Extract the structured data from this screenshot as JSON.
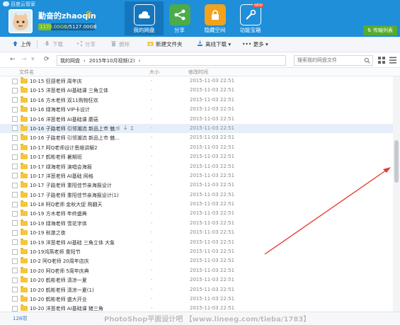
{
  "app": {
    "title": "百度云管家",
    "username": "勤奋的zhaoqin",
    "quota_used": "1170.00GB",
    "quota_sep": "/",
    "quota_total": "5127.00GB",
    "quota_fraction": 0.228,
    "transfer_label": "传输列表"
  },
  "nav": {
    "tabs": [
      {
        "label": "我的网盘",
        "icon": "cloud-icon"
      },
      {
        "label": "分享",
        "icon": "share-icon"
      },
      {
        "label": "隐藏空间",
        "icon": "lock-icon"
      },
      {
        "label": "功能宝箱",
        "icon": "toolbox-icon"
      }
    ],
    "new_tag": "NEW"
  },
  "toolbar": {
    "upload": "上传",
    "download": "下载",
    "share": "分享",
    "delete": "删除",
    "new_folder": "新建文件夹",
    "offline_download": "离线下载",
    "more": "更多"
  },
  "address": {
    "crumbs": [
      "我的网盘",
      "›",
      "2015年10月视频(2)",
      "›"
    ],
    "search_placeholder": "搜索我的网盘文件"
  },
  "columns": {
    "name": "文件名",
    "size": "大小",
    "modified": "修改时间"
  },
  "files": [
    {
      "name": "10-15 狂感老师 周年庆",
      "size": "-",
      "date": "2015-11-03 22:51"
    },
    {
      "name": "10-15 洋葱老师 AI基础课 三角立体",
      "size": "-",
      "date": "2015-11-03 22:51"
    },
    {
      "name": "10-16 方木老师 双11购物狂欢",
      "size": "-",
      "date": "2015-11-03 22:51"
    },
    {
      "name": "10-16 绿海老师 VIP卡设计",
      "size": "-",
      "date": "2015-11-03 22:51"
    },
    {
      "name": "10-16 洋葱老师 AI基础课 蘑菇",
      "size": "-",
      "date": "2015-11-03 22:51"
    },
    {
      "name": "10-16 子路老师 引领潮流 新品上市 魅...",
      "size": "-",
      "date": "2015-11-03 22:51",
      "selected": true
    },
    {
      "name": "10-16 子路老师 引领潮流 新品上市 魅...",
      "size": "-",
      "date": "2015-11-03 22:51"
    },
    {
      "name": "10-17 阿Q老师设计思维讲解2",
      "size": "-",
      "date": "2015-11-03 22:51"
    },
    {
      "name": "10-17 鹤彬老师 暑期班",
      "size": "-",
      "date": "2015-11-03 22:51"
    },
    {
      "name": "10-17 绿海老师 演唱会海报",
      "size": "-",
      "date": "2015-11-03 22:51"
    },
    {
      "name": "10-17 洋葱老师 AI基础 网格",
      "size": "-",
      "date": "2015-11-03 22:51"
    },
    {
      "name": "10-17 子路老师 重阳佳节亲海报设计",
      "size": "-",
      "date": "2015-11-03 22:51"
    },
    {
      "name": "10-17 子路老师 重阳佳节亲海报设计(1)",
      "size": "-",
      "date": "2015-11-03 22:51"
    },
    {
      "name": "10-18 阿Q老师 金秋大促 购翻天",
      "size": "-",
      "date": "2015-11-03 22:51"
    },
    {
      "name": "10-19 方木老师 年终盛典",
      "size": "-",
      "date": "2015-11-03 22:51"
    },
    {
      "name": "10-19 绿海老师 雪花字体",
      "size": "-",
      "date": "2015-11-03 22:51"
    },
    {
      "name": "10-19 秋澈之夜",
      "size": "-",
      "date": "2015-11-03 22:51"
    },
    {
      "name": "10-19 洋葱老师 AI基础 三角立体 大象",
      "size": "-",
      "date": "2015-11-03 22:51"
    },
    {
      "name": "10-19鸿燕老师 重阳节",
      "size": "-",
      "date": "2015-11-03 22:51"
    },
    {
      "name": "10-2 阿Q老师 20周年店庆",
      "size": "-",
      "date": "2015-11-03 22:51"
    },
    {
      "name": "10-20 阿Q老师 5周年庆典",
      "size": "-",
      "date": "2015-11-03 22:51"
    },
    {
      "name": "10-20 鹤彬老师 清凉一夏",
      "size": "-",
      "date": "2015-11-03 22:51"
    },
    {
      "name": "10-20 鹤彬老师 清凉一夏(1)",
      "size": "-",
      "date": "2015-11-03 22:51"
    },
    {
      "name": "10-20 鹤彬老师 盛大开业",
      "size": "-",
      "date": "2015-11-03 22:51"
    },
    {
      "name": "10-20 洋葱老师 AI基础课 猪三角",
      "size": "-",
      "date": "2015-11-03 22:51"
    }
  ],
  "status": {
    "count": "128项",
    "watermark": "PhotoShop平面设计吧 【www.lineeg.com/tieba/1783】"
  },
  "colors": {
    "header": "#1e8fd8",
    "accent_green": "#57aa2e",
    "folder": "#f4c53e",
    "annotation_arrow": "#e6382e"
  }
}
